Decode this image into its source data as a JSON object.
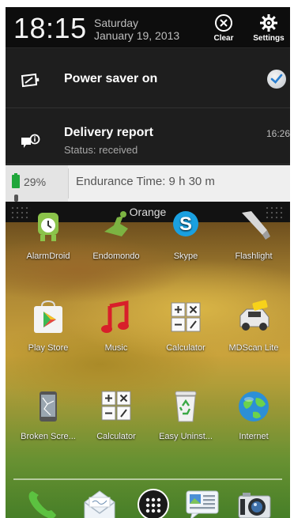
{
  "status": {
    "time": "18:15",
    "day": "Saturday",
    "date": "January 19, 2013",
    "clear_label": "Clear",
    "settings_label": "Settings"
  },
  "notifications": [
    {
      "title": "Power saver on",
      "icon": "battery-saver-icon"
    },
    {
      "title": "Delivery report",
      "subtitle": "Status: received",
      "time": "16:26",
      "icon": "message-info-icon"
    }
  ],
  "battery_widget": {
    "battery_percent": "29%",
    "endurance": "Endurance Time: 9 h 30 m"
  },
  "carrier": "Orange",
  "apps": [
    {
      "label": "AlarmDroid",
      "icon": "alarm-droid-icon"
    },
    {
      "label": "Endomondo",
      "icon": "endomondo-icon"
    },
    {
      "label": "Skype",
      "icon": "skype-icon"
    },
    {
      "label": "Flashlight",
      "icon": "flashlight-icon"
    },
    {
      "label": "Play Store",
      "icon": "play-store-icon"
    },
    {
      "label": "Music",
      "icon": "music-icon"
    },
    {
      "label": "Calculator",
      "icon": "calculator-icon"
    },
    {
      "label": "MDScan Lite",
      "icon": "mdscan-icon"
    },
    {
      "label": "Broken Scre...",
      "icon": "broken-screen-icon"
    },
    {
      "label": "Calculator",
      "icon": "calculator-icon"
    },
    {
      "label": "Easy Uninst...",
      "icon": "recycle-bin-icon"
    },
    {
      "label": "Internet",
      "icon": "globe-icon"
    }
  ],
  "dock": [
    {
      "icon": "phone-icon"
    },
    {
      "icon": "mail-icon"
    },
    {
      "icon": "app-drawer-icon"
    },
    {
      "icon": "messages-icon"
    },
    {
      "icon": "camera-icon"
    }
  ],
  "colors": {
    "shade_bg": "#1b1b1b",
    "battery_green": "#1fa63a",
    "check_blue": "#2a7fd0"
  }
}
